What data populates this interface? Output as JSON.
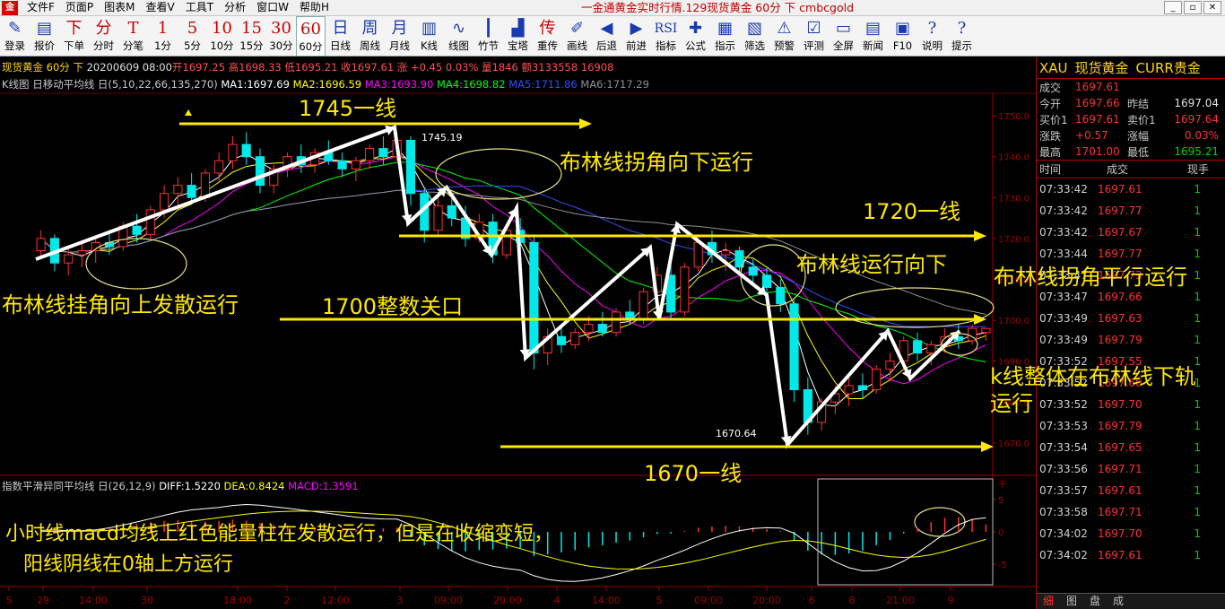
{
  "app": {
    "logo": "金",
    "menu": [
      "文件F",
      "页面P",
      "图表M",
      "查看V",
      "工具T",
      "分析",
      "窗口W",
      "帮助H"
    ],
    "title": "一金通黄金实时行情.129现货黄金 60分 下 cmbcgold",
    "controls": [
      "_",
      "▫",
      "✕"
    ]
  },
  "toolbar": [
    {
      "id": "login",
      "icon": "✎",
      "label": "登录"
    },
    {
      "id": "quote",
      "icon": "▤",
      "label": "报价"
    },
    {
      "id": "order",
      "icon": "下",
      "label": "下单"
    },
    {
      "id": "tick",
      "icon": "分",
      "label": "分时"
    },
    {
      "id": "trans",
      "icon": "T",
      "label": "分笔"
    },
    {
      "id": "m1",
      "icon": "1",
      "label": "1分"
    },
    {
      "id": "m5",
      "icon": "5",
      "label": "5分"
    },
    {
      "id": "m10",
      "icon": "10",
      "label": "10分"
    },
    {
      "id": "m15",
      "icon": "15",
      "label": "15分"
    },
    {
      "id": "m30",
      "icon": "30",
      "label": "30分"
    },
    {
      "id": "m60",
      "icon": "60",
      "label": "60分"
    },
    {
      "id": "day",
      "icon": "日",
      "label": "日线"
    },
    {
      "id": "week",
      "icon": "周",
      "label": "周线"
    },
    {
      "id": "month",
      "icon": "月",
      "label": "月线"
    },
    {
      "id": "kline",
      "icon": "▥",
      "label": "K线"
    },
    {
      "id": "lines",
      "icon": "∿",
      "label": "线图"
    },
    {
      "id": "bamboo",
      "icon": "┃",
      "label": "竹节"
    },
    {
      "id": "tower",
      "icon": "▟",
      "label": "宝塔"
    },
    {
      "id": "repub",
      "icon": "传",
      "label": "重传"
    },
    {
      "id": "draw",
      "icon": "✐",
      "label": "画线"
    },
    {
      "id": "back",
      "icon": "◀",
      "label": "后退"
    },
    {
      "id": "fwd",
      "icon": "▶",
      "label": "前进"
    },
    {
      "id": "ind",
      "icon": "RSI",
      "label": "指标"
    },
    {
      "id": "formula",
      "icon": "✚",
      "label": "公式"
    },
    {
      "id": "idx",
      "icon": "▦",
      "label": "指示"
    },
    {
      "id": "filter",
      "icon": "▧",
      "label": "筛选"
    },
    {
      "id": "alert",
      "icon": "⚠",
      "label": "预警"
    },
    {
      "id": "eval",
      "icon": "☑",
      "label": "评测"
    },
    {
      "id": "full",
      "icon": "▭",
      "label": "全屏"
    },
    {
      "id": "news",
      "icon": "▤",
      "label": "新闻"
    },
    {
      "id": "f10",
      "icon": "▣",
      "label": "F10"
    },
    {
      "id": "help",
      "icon": "?",
      "label": "说明"
    },
    {
      "id": "tips",
      "icon": "?",
      "label": "提示"
    }
  ],
  "info": {
    "line1_name": "现货黄金 60分 下",
    "line1_date": "20200609 08:00",
    "line1_rest": "开1697.25 高1698.33 低1695.21 收1697.61 涨 +0.45 0.03% 量1846 额3133558 16908",
    "line2_title": "K线图 日移动平均线 日(5,10,22,66,135,270)",
    "ma1": "MA1:1697.69",
    "ma2": "MA2:1696.59",
    "ma3": "MA3:1693.90",
    "ma4": "MA4:1698.82",
    "ma5": "MA5:1711.86",
    "ma6": "MA6:1717.29",
    "macd_title": "指数平滑异同平均线 日(26,12,9)",
    "diff": "DIFF:1.5220",
    "dea": "DEA:0.8424",
    "macd": "MACD:1.3591"
  },
  "colors": {
    "up": "#ff3030",
    "down": "#00e8e8",
    "annotation": "#ffe800",
    "ma1": "#ffffff",
    "ma2": "#ffff00",
    "ma3": "#ff00ff",
    "ma4": "#00ff00",
    "ma5": "#3050ff",
    "ma6": "#909090"
  },
  "axis": {
    "price_ticks": [
      "1750.0",
      "1740.0",
      "1730.0",
      "1720.0",
      "1710.0",
      "1700.0",
      "1690.0",
      "1680.0",
      "1670.0"
    ],
    "macd_ticks": [
      "5",
      "0",
      "-5"
    ],
    "time_labels": [
      "5",
      "29",
      "14:00",
      "30",
      "18:00",
      "2",
      "12:00",
      "3",
      "09:00",
      "20:00",
      "4",
      "14:00",
      "5",
      "09:00",
      "20:00",
      "6",
      "8",
      "21:00",
      "9"
    ],
    "high_label": "1745.19",
    "low_label": "1670.64",
    "macd_corner": "千"
  },
  "chart_data": {
    "type": "candlestick",
    "title": "现货黄金 60分",
    "ylim": [
      1666,
      1752
    ],
    "candles": [
      [
        1717,
        1722,
        1715,
        1720
      ],
      [
        1720,
        1721,
        1712,
        1714
      ],
      [
        1714,
        1718,
        1711,
        1716
      ],
      [
        1716,
        1719,
        1713,
        1717
      ],
      [
        1717,
        1720,
        1714,
        1719
      ],
      [
        1719,
        1722,
        1716,
        1718
      ],
      [
        1718,
        1724,
        1717,
        1723
      ],
      [
        1723,
        1726,
        1719,
        1721
      ],
      [
        1721,
        1728,
        1720,
        1727
      ],
      [
        1727,
        1733,
        1725,
        1731
      ],
      [
        1731,
        1735,
        1728,
        1733
      ],
      [
        1733,
        1736,
        1729,
        1730
      ],
      [
        1730,
        1737,
        1729,
        1736
      ],
      [
        1736,
        1741,
        1734,
        1739
      ],
      [
        1739,
        1745,
        1737,
        1743
      ],
      [
        1743,
        1746,
        1738,
        1740
      ],
      [
        1740,
        1742,
        1731,
        1733
      ],
      [
        1733,
        1738,
        1731,
        1737
      ],
      [
        1737,
        1741,
        1735,
        1740
      ],
      [
        1740,
        1743,
        1736,
        1738
      ],
      [
        1738,
        1742,
        1736,
        1741
      ],
      [
        1741,
        1744,
        1738,
        1739
      ],
      [
        1739,
        1741,
        1735,
        1737
      ],
      [
        1737,
        1740,
        1734,
        1739
      ],
      [
        1739,
        1743,
        1737,
        1742
      ],
      [
        1742,
        1745,
        1738,
        1740
      ],
      [
        1740,
        1745,
        1739,
        1744
      ],
      [
        1744,
        1745,
        1728,
        1731
      ],
      [
        1731,
        1732,
        1719,
        1722
      ],
      [
        1722,
        1730,
        1721,
        1728
      ],
      [
        1728,
        1730,
        1723,
        1725
      ],
      [
        1725,
        1728,
        1718,
        1720
      ],
      [
        1720,
        1726,
        1719,
        1724
      ],
      [
        1724,
        1726,
        1714,
        1716
      ],
      [
        1716,
        1723,
        1715,
        1722
      ],
      [
        1722,
        1725,
        1717,
        1719
      ],
      [
        1719,
        1721,
        1688,
        1692
      ],
      [
        1692,
        1698,
        1689,
        1696
      ],
      [
        1696,
        1699,
        1692,
        1694
      ],
      [
        1694,
        1698,
        1693,
        1697
      ],
      [
        1697,
        1701,
        1695,
        1699
      ],
      [
        1699,
        1702,
        1696,
        1697
      ],
      [
        1697,
        1703,
        1696,
        1702
      ],
      [
        1702,
        1705,
        1699,
        1700
      ],
      [
        1700,
        1708,
        1699,
        1707
      ],
      [
        1707,
        1713,
        1705,
        1711
      ],
      [
        1711,
        1714,
        1700,
        1702
      ],
      [
        1702,
        1714,
        1701,
        1713
      ],
      [
        1713,
        1721,
        1712,
        1719
      ],
      [
        1719,
        1722,
        1714,
        1716
      ],
      [
        1716,
        1719,
        1712,
        1717
      ],
      [
        1717,
        1718,
        1711,
        1713
      ],
      [
        1713,
        1715,
        1709,
        1711
      ],
      [
        1711,
        1713,
        1706,
        1708
      ],
      [
        1708,
        1710,
        1702,
        1704
      ],
      [
        1704,
        1705,
        1680,
        1683
      ],
      [
        1683,
        1686,
        1672,
        1675
      ],
      [
        1675,
        1681,
        1673,
        1680
      ],
      [
        1680,
        1684,
        1677,
        1682
      ],
      [
        1682,
        1686,
        1679,
        1684
      ],
      [
        1684,
        1687,
        1681,
        1683
      ],
      [
        1683,
        1689,
        1682,
        1688
      ],
      [
        1688,
        1692,
        1685,
        1690
      ],
      [
        1690,
        1696,
        1688,
        1695
      ],
      [
        1695,
        1697,
        1690,
        1692
      ],
      [
        1692,
        1695,
        1689,
        1694
      ],
      [
        1694,
        1698,
        1692,
        1696
      ],
      [
        1696,
        1699,
        1693,
        1695
      ],
      [
        1695,
        1699,
        1694,
        1698
      ],
      [
        1697,
        1698,
        1695,
        1698
      ]
    ],
    "macd_hist": [
      0.5,
      0.3,
      -0.2,
      0.1,
      0.4,
      0.8,
      1.2,
      1.5,
      1.8,
      2.0,
      2.2,
      2.1,
      1.9,
      2.0,
      2.3,
      2.1,
      1.6,
      1.3,
      1.2,
      1.0,
      0.9,
      0.8,
      0.6,
      0.5,
      0.6,
      0.7,
      0.8,
      -1.0,
      -2.5,
      -3.2,
      -3.5,
      -3.6,
      -3.4,
      -3.3,
      -3.1,
      -3.0,
      -4.5,
      -4.2,
      -3.8,
      -3.4,
      -2.9,
      -2.5,
      -2.0,
      -1.6,
      -1.0,
      -0.4,
      -0.3,
      0.2,
      0.8,
      1.0,
      1.1,
      1.0,
      0.8,
      0.5,
      0.2,
      -1.5,
      -3.5,
      -4.2,
      -4.3,
      -4.0,
      -3.5,
      -2.5,
      -1.5,
      -0.3,
      0.8,
      1.8,
      2.6,
      2.8,
      2.3,
      1.4
    ]
  },
  "right_panel": {
    "symbol": "XAU",
    "name": "现货黄金",
    "market": "CURR贵金",
    "last_label": "成交",
    "last": "1697.61",
    "rows": [
      {
        "l1": "今开",
        "v1": "1697.66",
        "l2": "昨结",
        "v2": "1697.04",
        "c1": "#ff3030",
        "c2": "#e0e0e0"
      },
      {
        "l1": "买价1",
        "v1": "1697.61",
        "l2": "卖价1",
        "v2": "1697.64",
        "c1": "#ff3030",
        "c2": "#ff3030"
      },
      {
        "l1": "涨跌",
        "v1": "+0.57",
        "l2": "涨幅",
        "v2": "0.03%",
        "c1": "#ff3030",
        "c2": "#ff3030"
      },
      {
        "l1": "最高",
        "v1": "1701.00",
        "l2": "最低",
        "v2": "1695.21",
        "c1": "#ff3030",
        "c2": "#00d000"
      }
    ],
    "tick_headers": [
      "时间",
      "成交",
      "现手"
    ],
    "ticks": [
      [
        "07:33:42",
        "1697.61",
        "1"
      ],
      [
        "07:33:42",
        "1697.77",
        "1"
      ],
      [
        "07:33:42",
        "1697.67",
        "1"
      ],
      [
        "07:33:44",
        "1697.77",
        "1"
      ],
      [
        "07:33:47",
        "1697.73",
        "1"
      ],
      [
        "07:33:47",
        "1697.66",
        "1"
      ],
      [
        "07:33:49",
        "1697.63",
        "1"
      ],
      [
        "07:33:49",
        "1697.79",
        "1"
      ],
      [
        "07:33:52",
        "1697.55",
        "1"
      ],
      [
        "07:33:52",
        "1697.60",
        "1"
      ],
      [
        "07:33:52",
        "1697.70",
        "1"
      ],
      [
        "07:33:53",
        "1697.79",
        "1"
      ],
      [
        "07:33:54",
        "1697.65",
        "1"
      ],
      [
        "07:33:56",
        "1697.71",
        "1"
      ],
      [
        "07:33:57",
        "1697.61",
        "1"
      ],
      [
        "07:33:58",
        "1697.71",
        "1"
      ],
      [
        "07:34:02",
        "1697.70",
        "1"
      ],
      [
        "07:34:02",
        "1697.61",
        "1"
      ]
    ],
    "tabs": [
      "细",
      "图",
      "盘",
      "成"
    ]
  },
  "annotations": {
    "line_1745": "1745一线",
    "line_1720": "1720一线",
    "line_1700": "1700整数关口",
    "line_1670": "1670一线",
    "boll_up": "布林线挂角向上发散运行",
    "boll_turn_down": "布林线拐角向下运行",
    "boll_down": "布林线运行向下",
    "boll_flat": "布林线拐角平行运行",
    "k_below": "k线整体在布林线下轨运行",
    "macd_note_1": "小时线macd均线上红色能量柱在发散运行，但是在收缩变短，",
    "macd_note_2": "阳线阴线在0轴上方运行"
  }
}
